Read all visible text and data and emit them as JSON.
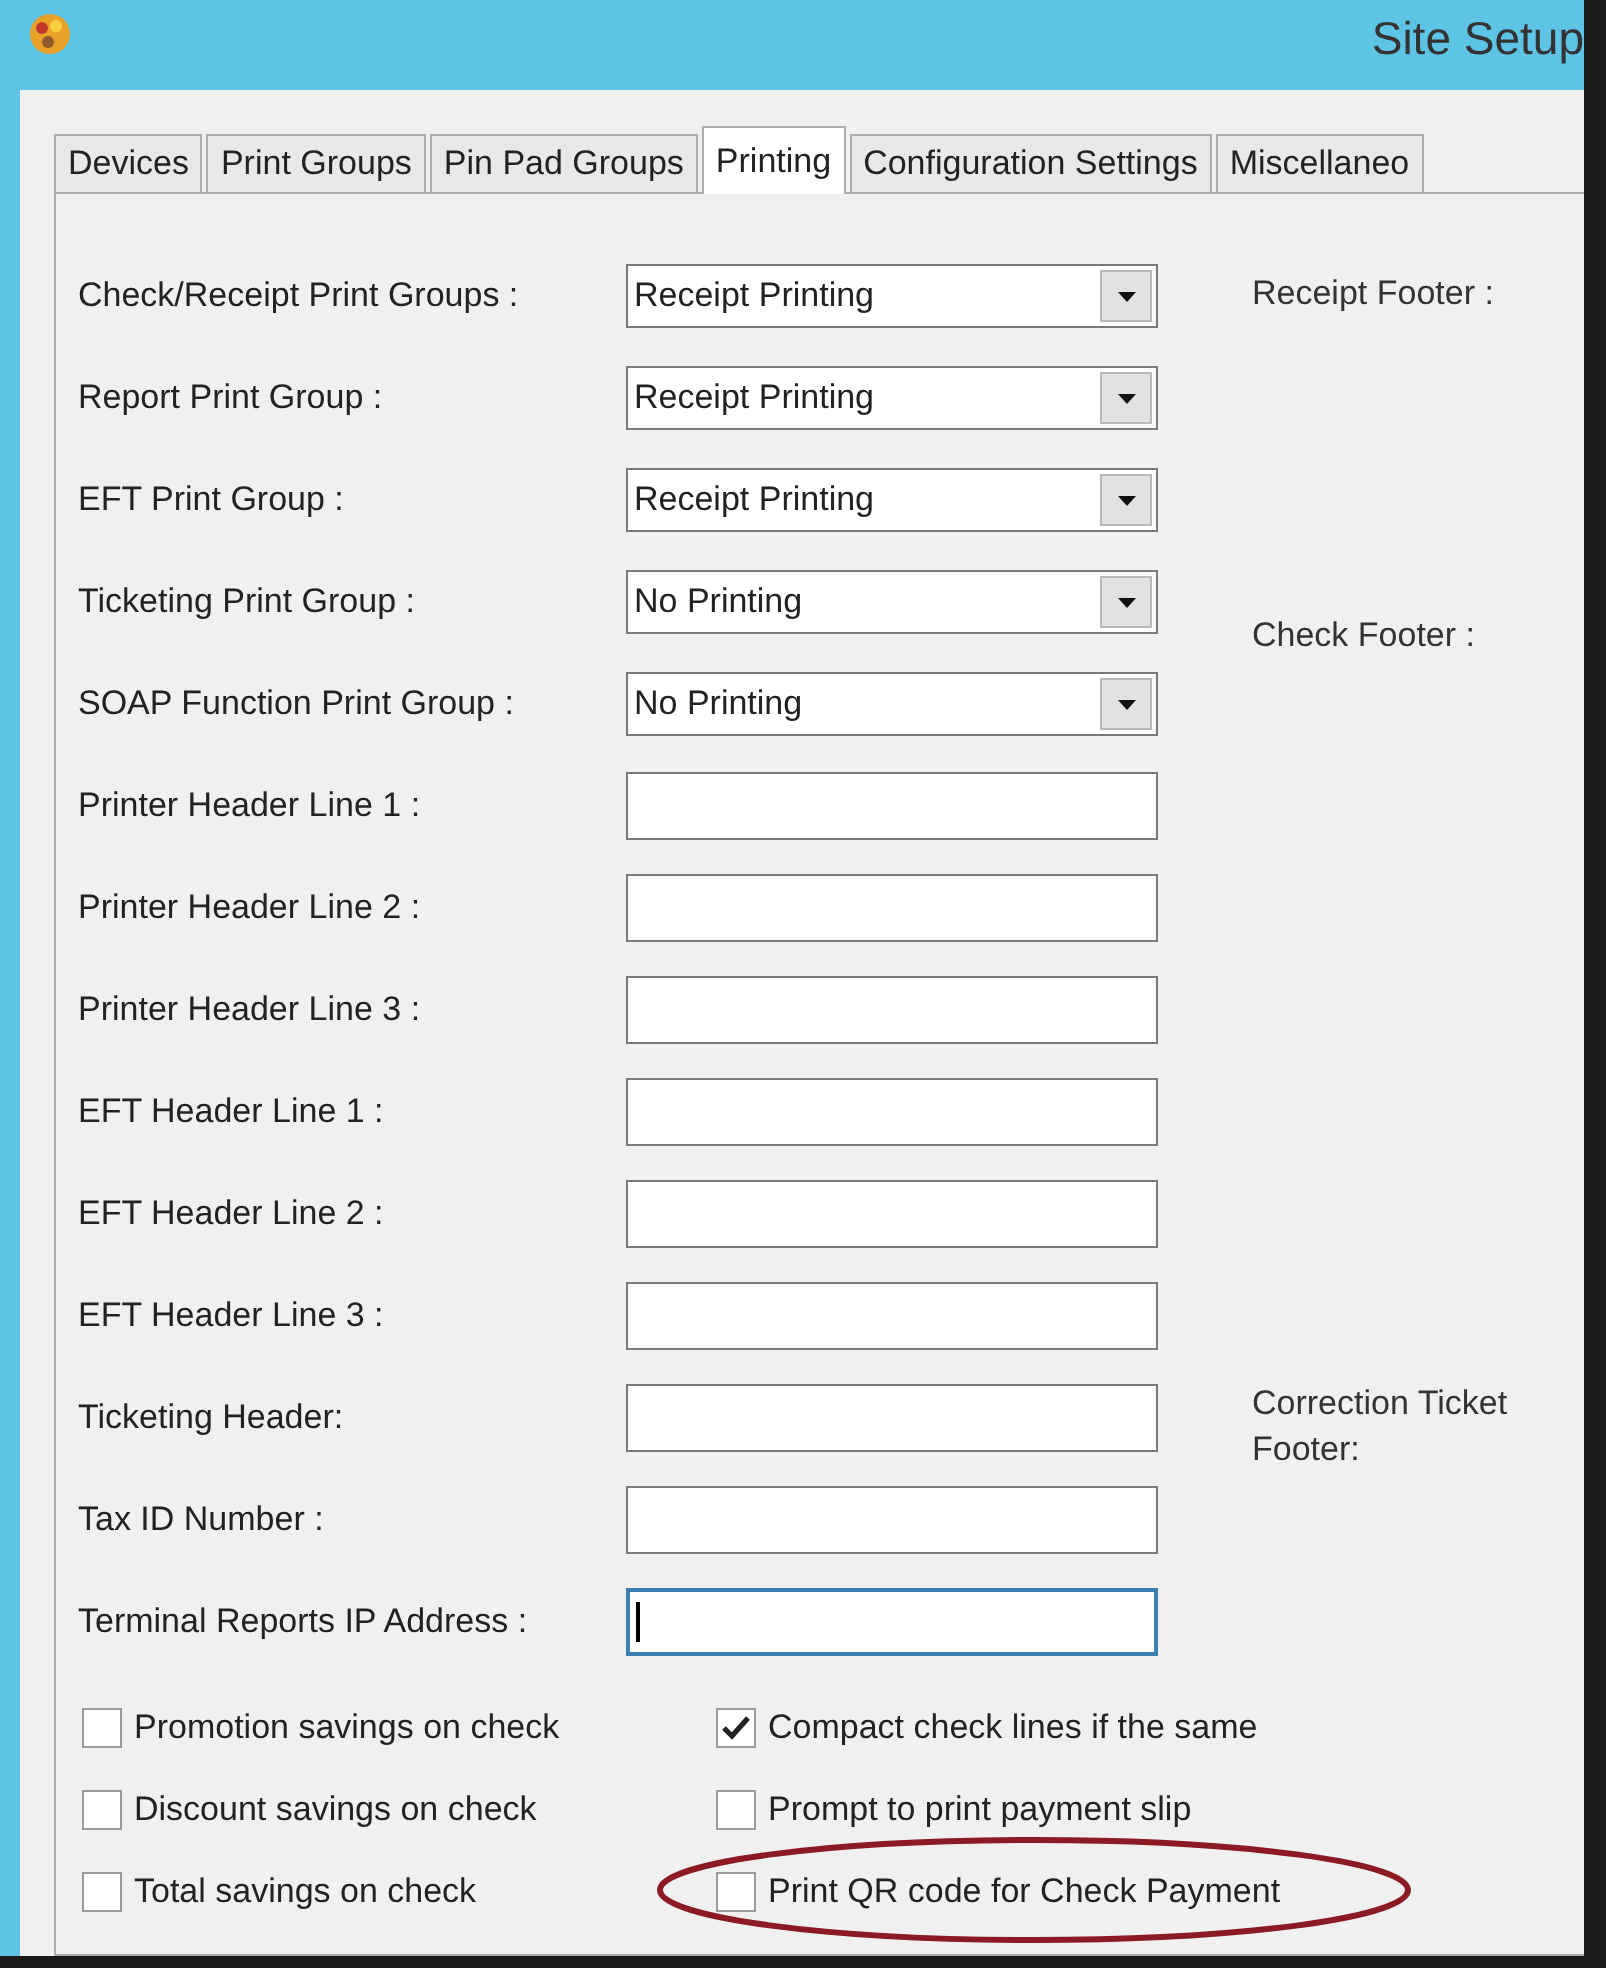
{
  "window": {
    "title": "Site Setup"
  },
  "tabs": [
    {
      "label": "Devices",
      "selected": false
    },
    {
      "label": "Print Groups",
      "selected": false
    },
    {
      "label": "Pin Pad Groups",
      "selected": false
    },
    {
      "label": "Printing",
      "selected": true
    },
    {
      "label": "Configuration Settings",
      "selected": false
    },
    {
      "label": "Miscellaneo",
      "selected": false
    }
  ],
  "fields": [
    {
      "label": "Check/Receipt Print Groups :",
      "kind": "dropdown",
      "value": "Receipt Printing"
    },
    {
      "label": "Report Print Group :",
      "kind": "dropdown",
      "value": "Receipt Printing"
    },
    {
      "label": "EFT Print Group :",
      "kind": "dropdown",
      "value": "Receipt Printing"
    },
    {
      "label": "Ticketing Print Group :",
      "kind": "dropdown",
      "value": "No Printing"
    },
    {
      "label": "SOAP Function Print Group :",
      "kind": "dropdown",
      "value": "No Printing"
    },
    {
      "label": "Printer Header Line 1 :",
      "kind": "text",
      "focused": false
    },
    {
      "label": "Printer Header Line 2 :",
      "kind": "text",
      "focused": false
    },
    {
      "label": "Printer Header Line 3 :",
      "kind": "text",
      "focused": false
    },
    {
      "label": "EFT Header Line 1 :",
      "kind": "text",
      "focused": false
    },
    {
      "label": "EFT Header Line 2 :",
      "kind": "text",
      "focused": false
    },
    {
      "label": "EFT Header Line 3 :",
      "kind": "text",
      "focused": false
    },
    {
      "label": "Ticketing Header:",
      "kind": "text",
      "focused": false
    },
    {
      "label": "Tax ID Number :",
      "kind": "text",
      "focused": false
    },
    {
      "label": "Terminal Reports IP Address :",
      "kind": "text",
      "focused": true
    }
  ],
  "footers": [
    "Receipt Footer :",
    "Check Footer :",
    "Correction Ticket Footer:"
  ],
  "checkboxes": [
    {
      "label": "Promotion savings on check",
      "checked": false,
      "circled": false
    },
    {
      "label": "Compact check lines if the same",
      "checked": true,
      "circled": false
    },
    {
      "label": "Discount savings on check",
      "checked": false,
      "circled": false
    },
    {
      "label": "Prompt to print payment slip",
      "checked": false,
      "circled": false
    },
    {
      "label": "Total savings on check",
      "checked": false,
      "circled": false
    },
    {
      "label": "Print QR code for Check Payment",
      "checked": false,
      "circled": true
    }
  ]
}
